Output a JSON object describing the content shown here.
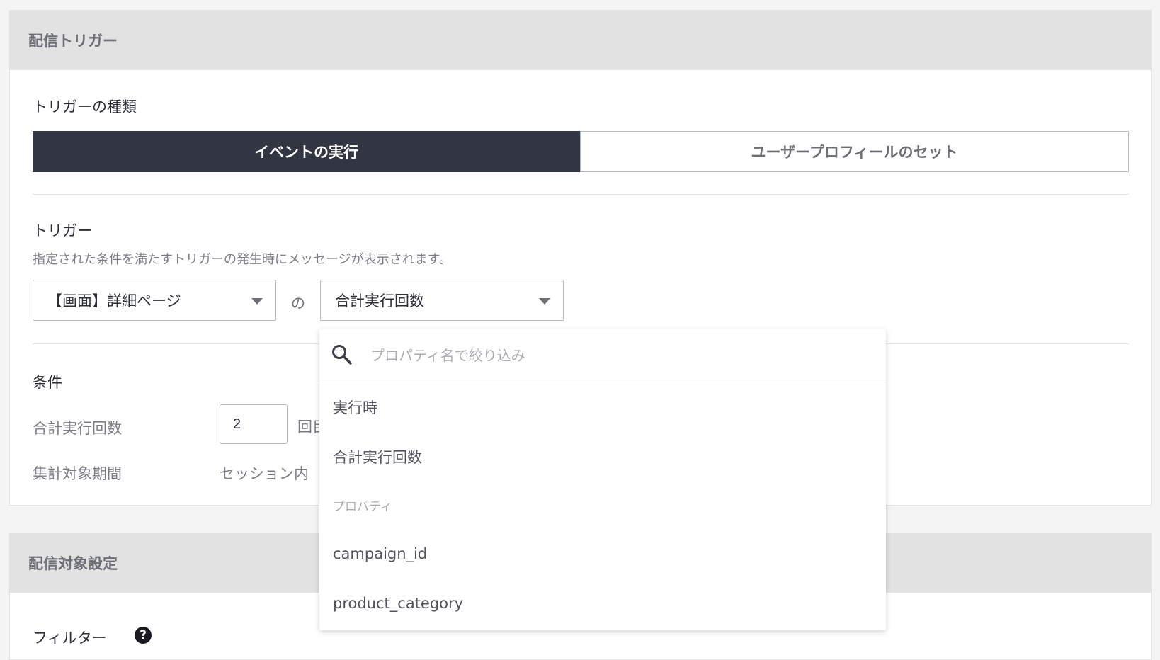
{
  "delivery_trigger_section": {
    "title": "配信トリガー",
    "trigger_type_label": "トリガーの種類",
    "trigger_type_options": [
      "イベントの実行",
      "ユーザープロフィールのセット"
    ],
    "trigger_label": "トリガー",
    "trigger_description": "指定された条件を満たすトリガーの発生時にメッセージが表示されます。",
    "event_select_value": "【画面】詳細ページ",
    "connector": "の",
    "property_select_value": "合計実行回数",
    "condition_label": "条件",
    "conditions": [
      {
        "label": "合計実行回数",
        "value": "2",
        "suffix": "回目"
      },
      {
        "label": "集計対象期間",
        "value": "セッション内"
      }
    ]
  },
  "property_dropdown": {
    "search_placeholder": "プロパティ名で絞り込み",
    "items": [
      "実行時",
      "合計実行回数"
    ],
    "group_label": "プロパティ",
    "group_items": [
      "campaign_id",
      "product_category"
    ]
  },
  "delivery_target_section": {
    "title": "配信対象設定",
    "filter_label": "フィルター",
    "help_glyph": "?"
  },
  "colors": {
    "active_segment": "#323642",
    "section_header_bg": "#e2e2e2",
    "page_bg": "#f4f4f4"
  }
}
